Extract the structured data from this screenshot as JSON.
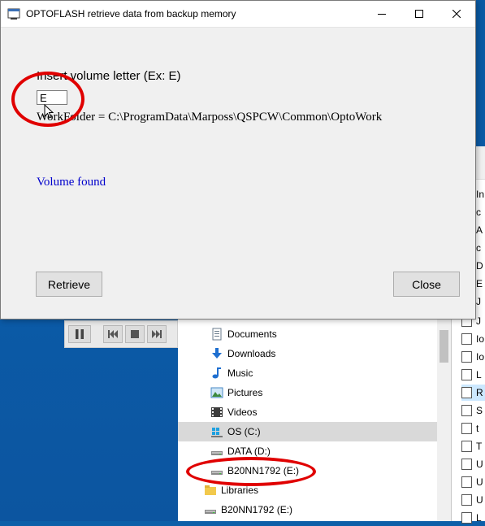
{
  "dialog": {
    "title": "OPTOFLASH retrieve data from backup memory",
    "prompt": "Insert volume letter (Ex: E)",
    "volume_value": "E",
    "workfolder": "WorkFolder = C:\\ProgramData\\Marposs\\QSPCW\\Common\\OptoWork",
    "status": "Volume found",
    "retrieve_label": "Retrieve",
    "close_label": "Close"
  },
  "explorer": {
    "items": [
      {
        "label": "Documents",
        "icon": "documents-icon"
      },
      {
        "label": "Downloads",
        "icon": "downloads-icon"
      },
      {
        "label": "Music",
        "icon": "music-icon"
      },
      {
        "label": "Pictures",
        "icon": "pictures-icon"
      },
      {
        "label": "Videos",
        "icon": "videos-icon"
      },
      {
        "label": "OS (C:)",
        "icon": "drive-c-icon"
      },
      {
        "label": "DATA (D:)",
        "icon": "drive-d-icon"
      },
      {
        "label": "B20NN1792 (E:)",
        "icon": "usb-drive-icon"
      },
      {
        "label": "Libraries",
        "icon": "libraries-icon"
      },
      {
        "label": "B20NN1792 (E:)",
        "icon": "usb-drive-icon"
      }
    ]
  },
  "background_list": {
    "items": [
      "In",
      "c",
      "A",
      "c",
      "D",
      "E",
      "J",
      "J",
      "Io",
      "Io",
      "L",
      "R",
      "S",
      "t",
      "T",
      "U",
      "U",
      "U",
      "L"
    ]
  },
  "colors": {
    "accent_status": "#0000cc",
    "annotation": "#e00000",
    "desktop": "#0b5aa6"
  }
}
